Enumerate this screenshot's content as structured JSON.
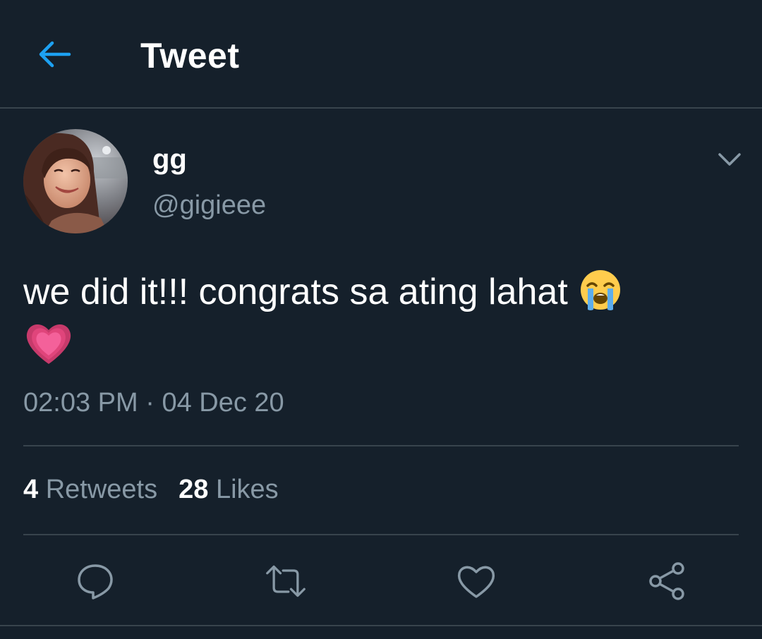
{
  "header": {
    "title": "Tweet",
    "back_icon": "arrow-left-icon",
    "accent_color": "#1da1f2"
  },
  "tweet": {
    "author": {
      "display_name": "gg",
      "handle": "@gigieee"
    },
    "text": "we did it!!! congrats sa ating lahat",
    "emojis": [
      "loudly-crying-face-icon",
      "growing-heart-icon"
    ],
    "time": "02:03 PM",
    "separator": "·",
    "date": "04 Dec 20"
  },
  "stats": {
    "retweets_count": "4",
    "retweets_label": "Retweets",
    "likes_count": "28",
    "likes_label": "Likes"
  },
  "actions": [
    "reply-icon",
    "retweet-icon",
    "like-icon",
    "share-icon"
  ],
  "colors": {
    "background": "#15202b",
    "secondary_text": "#8899a6",
    "divider": "#38444d"
  }
}
